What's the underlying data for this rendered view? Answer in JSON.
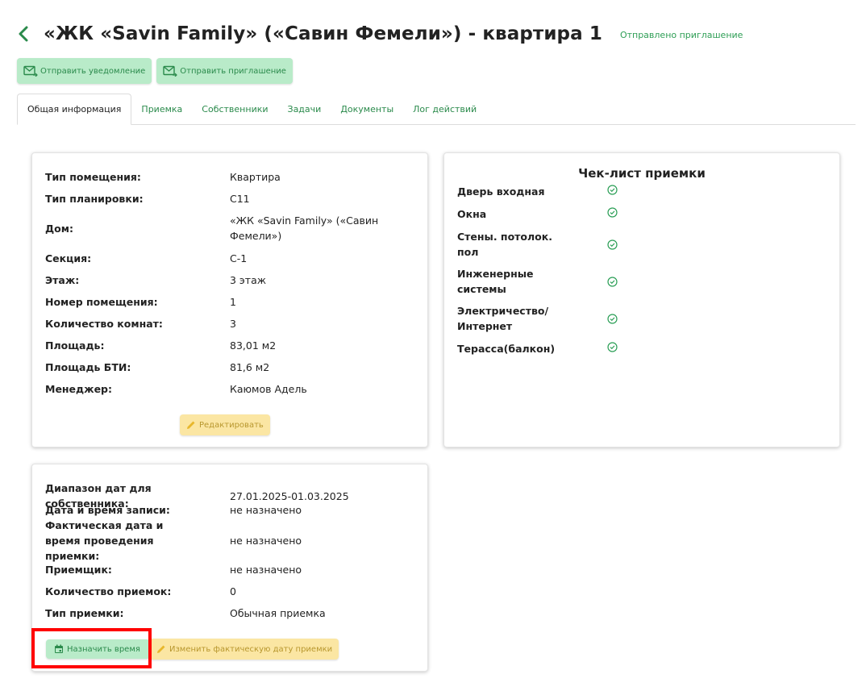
{
  "header": {
    "title": "«ЖК «Savin Family» («Савин Фемели») - квартира 1",
    "invite_status": "Отправлено приглашение"
  },
  "actions": {
    "send_notification": "Отправить уведомление",
    "send_invitation": "Отправить приглашение"
  },
  "tabs": [
    {
      "label": "Общая информация",
      "active": true
    },
    {
      "label": "Приемка",
      "active": false
    },
    {
      "label": "Собственники",
      "active": false
    },
    {
      "label": "Задачи",
      "active": false
    },
    {
      "label": "Документы",
      "active": false
    },
    {
      "label": "Лог действий",
      "active": false
    }
  ],
  "info": {
    "rows": [
      {
        "label": "Тип помещения:",
        "value": "Квартира"
      },
      {
        "label": "Тип планировки:",
        "value": "С11"
      },
      {
        "label": "Дом:",
        "value": "«ЖК «Savin Family» («Савин Фемели»)"
      },
      {
        "label": "Секция:",
        "value": "С-1"
      },
      {
        "label": "Этаж:",
        "value": "3 этаж"
      },
      {
        "label": "Номер помещения:",
        "value": "1"
      },
      {
        "label": "Количество комнат:",
        "value": "3"
      },
      {
        "label": "Площадь:",
        "value": "83,01 м2"
      },
      {
        "label": "Площадь БТИ:",
        "value": "81,6 м2"
      },
      {
        "label": "Менеджер:",
        "value": "Каюмов Адель"
      }
    ],
    "edit_label": "Редактировать"
  },
  "checklist": {
    "title": "Чек-лист приемки",
    "items": [
      {
        "label": "Дверь входная",
        "done": true
      },
      {
        "label": "Окна",
        "done": true
      },
      {
        "label": "Стены. потолок. пол",
        "done": true
      },
      {
        "label": "Инженерные системы",
        "done": true
      },
      {
        "label": "Электричество/ Интернет",
        "done": true
      },
      {
        "label": "Терасса(балкон)",
        "done": true
      }
    ]
  },
  "acceptance": {
    "rows": [
      {
        "label": "Диапазон дат для собственника:",
        "value": "27.01.2025-01.03.2025"
      },
      {
        "label": "Дата и время записи:",
        "value": "не назначено"
      },
      {
        "label": "Фактическая дата и время проведения приемки:",
        "value": "не назначено"
      },
      {
        "label": "Приемщик:",
        "value": "не назначено"
      },
      {
        "label": "Количество приемок:",
        "value": "0"
      },
      {
        "label": "Тип приемки:",
        "value": "Обычная приемка"
      }
    ],
    "assign_time_label": "Назначить время",
    "change_date_label": "Изменить фактическую дату приемки"
  },
  "colors": {
    "accent_green": "#2a8a4b",
    "button_green_bg": "#b9ebc9",
    "button_yellow_bg": "#fbe6a3",
    "highlight": "#ff0000"
  }
}
